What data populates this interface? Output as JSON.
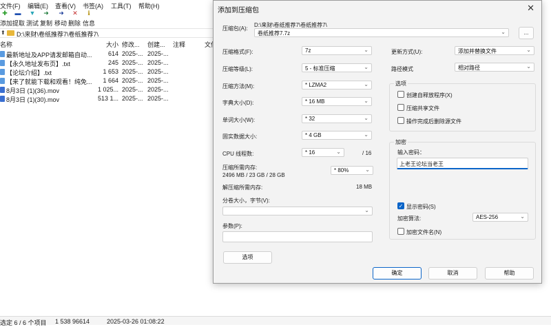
{
  "menu": [
    "文件(F)",
    "编辑(E)",
    "查看(V)",
    "书签(A)",
    "工具(T)",
    "帮助(H)"
  ],
  "toolbar": {
    "items": [
      {
        "label": "添加",
        "icon": "add-icon",
        "color": "#2a9d2a"
      },
      {
        "label": "提取",
        "icon": "extract-icon",
        "color": "#1f4fb0"
      },
      {
        "label": "测试",
        "icon": "test-icon",
        "color": "#2aa6b8"
      },
      {
        "label": "复制",
        "icon": "copy-icon",
        "color": "#1d7a3a"
      },
      {
        "label": "移动",
        "icon": "move-icon",
        "color": "#1f3f9a"
      },
      {
        "label": "删除",
        "icon": "delete-icon",
        "color": "#c42b2b"
      },
      {
        "label": "信息",
        "icon": "info-icon",
        "color": "#b08a00"
      }
    ]
  },
  "address": "D:\\来财\\卷纸推荐7\\卷纸推荐7\\",
  "columns": [
    "名称",
    "大小",
    "修改...",
    "创建...",
    "注释",
    "文件"
  ],
  "files": [
    {
      "name": "最新地址及APP请发邮箱自动...",
      "size": "614",
      "modified": "2025-...",
      "created": "2025-...",
      "icon": "file-icon"
    },
    {
      "name": "【永久地址发布页】.txt",
      "size": "245",
      "modified": "2025-...",
      "created": "2025-...",
      "icon": "file-icon"
    },
    {
      "name": "【论坛介绍】.txt",
      "size": "1 653",
      "modified": "2025-...",
      "created": "2025-...",
      "icon": "file-icon"
    },
    {
      "name": "【来了就能下载和观看！纯免...",
      "size": "1 664",
      "modified": "2025-...",
      "created": "2025-...",
      "icon": "file-icon"
    },
    {
      "name": "8月3日 (1)(36).mov",
      "size": "1 025...",
      "modified": "2025-...",
      "created": "2025-...",
      "icon": "video-icon"
    },
    {
      "name": "8月3日 (1)(30).mov",
      "size": "513 1...",
      "modified": "2025-...",
      "created": "2025-...",
      "icon": "video-icon"
    }
  ],
  "status": {
    "selection": "选定 6 / 6 个项目",
    "size": "1 538 96614",
    "datetime": "2025-03-26 01:08:22"
  },
  "dialog": {
    "title": "添加到压缩包",
    "archive_label": "压缩包(A):",
    "archive_path": "D:\\来财\\卷纸推荐7\\卷纸推荐7\\",
    "archive_name": "卷纸推荐7.7z",
    "browse_label": "...",
    "format_label": "压缩格式(F):",
    "format_value": "7z",
    "level_label": "压缩等级(L):",
    "level_value": "5 - 标准压缩",
    "method_label": "压缩方法(M):",
    "method_value": "* LZMA2",
    "dict_label": "字典大小(D):",
    "dict_value": "* 16 MB",
    "word_label": "单词大小(W):",
    "word_value": "* 32",
    "solid_label": "固实数据大小:",
    "solid_value": "* 4 GB",
    "cpu_label": "CPU 线程数:",
    "cpu_value": "* 16",
    "cpu_max": "/ 16",
    "mem_comp_label": "压缩所需内存:",
    "mem_comp_value": "2496 MB / 23 GB / 28 GB",
    "mem_pct": "* 80%",
    "mem_decomp_label": "解压缩所需内存:",
    "mem_decomp_value": "18 MB",
    "split_label": "分卷大小，字节(V):",
    "split_value": "",
    "params_label": "参数(P):",
    "params_value": "",
    "options_button": "选项",
    "update_label": "更新方式(U):",
    "update_value": "添加并替换文件",
    "path_label": "路径模式",
    "path_value": "相对路径",
    "options_group": "选项",
    "opt_sfx": "创建自释放程序(X)",
    "opt_shared": "压缩共享文件",
    "opt_delete": "操作完成后删除源文件",
    "encrypt_group": "加密",
    "password_label": "输入密码：",
    "password_value": "上老王论坛当老王",
    "show_password": "显示密码(S)",
    "enc_method_label": "加密算法:",
    "enc_method_value": "AES-256",
    "enc_names": "加密文件名(N)",
    "ok": "确定",
    "cancel": "取消",
    "help": "帮助",
    "close_icon": "close-icon",
    "accent": "#0a64c8"
  }
}
